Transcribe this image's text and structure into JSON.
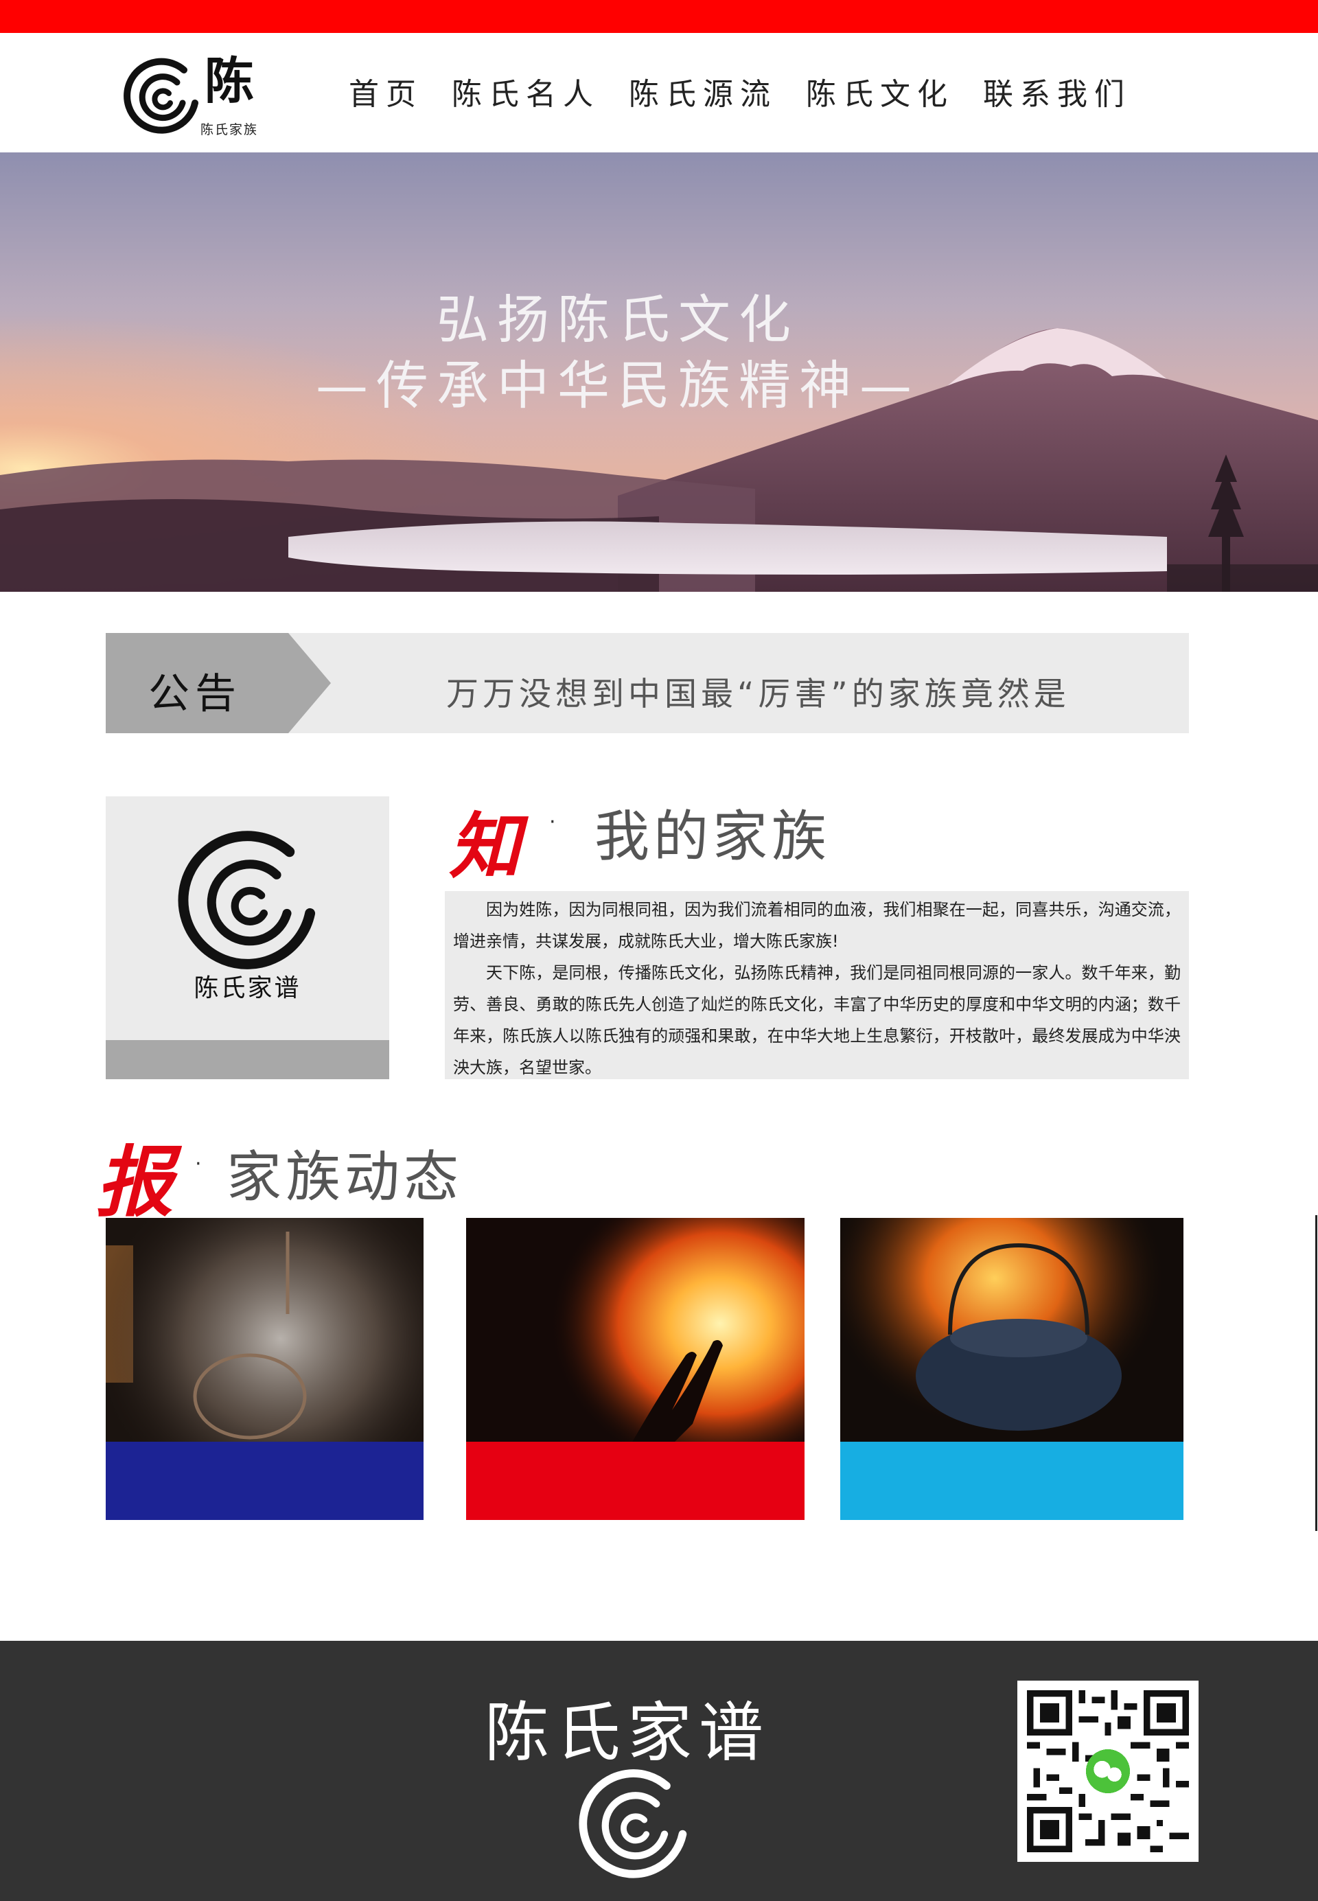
{
  "header": {
    "logo_char": "陈",
    "logo_sub": "陈氏家族",
    "nav": [
      "首页",
      "陈氏名人",
      "陈氏源流",
      "陈氏文化",
      "联系我们"
    ]
  },
  "hero": {
    "line1": "弘扬陈氏文化",
    "line2": "—传承中华民族精神—"
  },
  "notice": {
    "label": "公告",
    "text": "万万没想到中国最“厉害”的家族竟然是"
  },
  "family": {
    "card_title": "陈氏家谱",
    "brush_char": "知",
    "dot": "·",
    "title": "我的家族",
    "paragraphs": [
      "因为姓陈，因为同根同祖，因为我们流着相同的血液，我们相聚在一起，同喜共乐，沟通交流，增进亲情，共谋发展，成就陈氏大业，增大陈氏家族!",
      "天下陈，是同根，传播陈氏文化，弘扬陈氏精神，我们是同祖同根同源的一家人。数千年来，勤劳、善良、勇敢的陈氏先人创造了灿烂的陈氏文化，丰富了中华历史的厚度和中华文明的内涵；数千年来，陈氏族人以陈氏独有的顽强和果敢，在中华大地上生息繁衍，开枝散叶，最终发展成为中华泱泱大族，名望世家。"
    ]
  },
  "news": {
    "brush_char": "报",
    "dot": "·",
    "title": "家族动态",
    "cards": [
      {
        "image": "steaming-pot-photo",
        "strip_color": "#1c2394"
      },
      {
        "image": "fire-hand-photo",
        "strip_color": "#e60012"
      },
      {
        "image": "kettle-fire-photo",
        "strip_color": "#17aee2"
      }
    ]
  },
  "footer": {
    "title": "陈氏家谱",
    "qr": "wechat-qr-code"
  },
  "colors": {
    "accent_red": "#ff0000",
    "footer_bg": "#333333",
    "panel_gray": "#ebebeb"
  }
}
